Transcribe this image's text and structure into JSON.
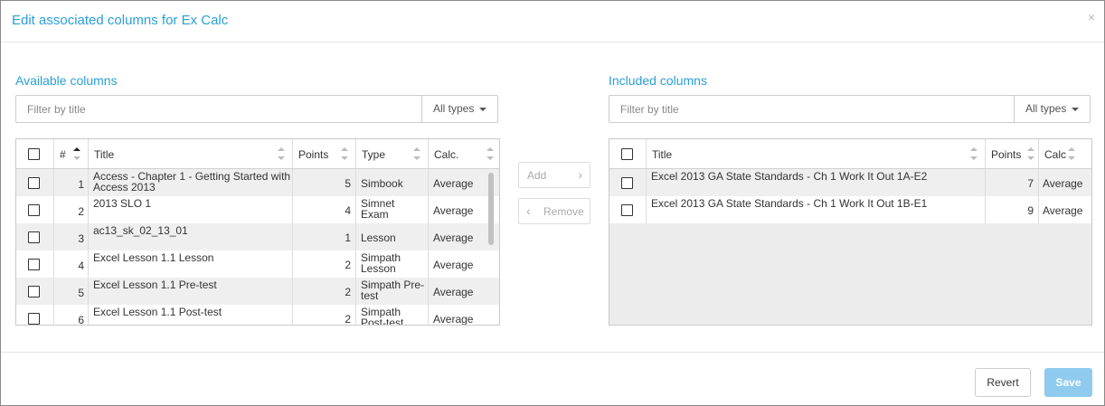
{
  "dialog": {
    "title": "Edit associated columns for Ex Calc",
    "close_glyph": "×"
  },
  "available": {
    "label": "Available columns",
    "filter_placeholder": "Filter by title",
    "type_filter": "All types",
    "headers": {
      "num": "#",
      "title": "Title",
      "points": "Points",
      "type": "Type",
      "calc": "Calc."
    },
    "rows": [
      {
        "num": "1",
        "title": "Access - Chapter 1 - Getting Started with Access 2013",
        "points": "5",
        "type": "Simbook",
        "calc": "Average"
      },
      {
        "num": "2",
        "title": "2013 SLO 1",
        "points": "4",
        "type": "Simnet Exam",
        "calc": "Average"
      },
      {
        "num": "3",
        "title": "ac13_sk_02_13_01",
        "points": "1",
        "type": "Lesson",
        "calc": "Average"
      },
      {
        "num": "4",
        "title": "Excel Lesson 1.1 Lesson",
        "points": "2",
        "type": "Simpath Lesson",
        "calc": "Average"
      },
      {
        "num": "5",
        "title": "Excel Lesson 1.1 Pre-test",
        "points": "2",
        "type": "Simpath Pre-test",
        "calc": "Average"
      },
      {
        "num": "6",
        "title": "Excel Lesson 1.1 Post-test",
        "points": "2",
        "type": "Simpath Post-test",
        "calc": "Average"
      }
    ]
  },
  "transfer": {
    "add_label": "Add",
    "add_icon": "›",
    "remove_label": "Remove",
    "remove_icon": "‹"
  },
  "included": {
    "label": "Included columns",
    "filter_placeholder": "Filter by title",
    "type_filter": "All types",
    "headers": {
      "title": "Title",
      "points": "Points",
      "calc": "Calc"
    },
    "rows": [
      {
        "title": "Excel 2013 GA State Standards - Ch 1 Work It Out 1A-E2",
        "points": "7",
        "calc": "Average"
      },
      {
        "title": "Excel 2013 GA State Standards - Ch 1 Work It Out 1B-E1",
        "points": "9",
        "calc": "Average"
      }
    ]
  },
  "footer": {
    "revert_label": "Revert",
    "save_label": "Save"
  },
  "colors": {
    "accent": "#2a9fd6",
    "save_button": "#8ecbef",
    "row_alt": "#efefef"
  }
}
